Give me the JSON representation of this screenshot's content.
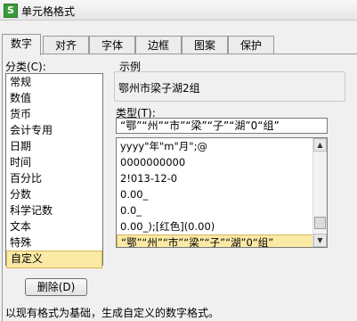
{
  "window": {
    "title": "单元格格式",
    "icon_text": "S"
  },
  "tabs": [
    {
      "label": "数字",
      "active": true
    },
    {
      "label": "对齐"
    },
    {
      "label": "字体"
    },
    {
      "label": "边框"
    },
    {
      "label": "图案"
    },
    {
      "label": "保护"
    }
  ],
  "category": {
    "label": "分类(C):",
    "items": [
      "常规",
      "数值",
      "货币",
      "会计专用",
      "日期",
      "时间",
      "百分比",
      "分数",
      "科学记数",
      "文本",
      "特殊",
      "自定义"
    ],
    "selected": "自定义"
  },
  "sample": {
    "label": "示例",
    "value": "鄂州市梁子湖2组"
  },
  "type": {
    "label": "类型(T):",
    "input_value": "“鄂”“州”“市”“梁”“子”“湖”0“组”",
    "list": [
      "yyyy\"年\"m\"月\";@",
      "0000000000",
      "2!013-12-0",
      "0.00_",
      "0.0_",
      "0.00_);[红色](0.00)",
      "“鄂”“州”“市”“梁”“子”“湖”0“组”"
    ],
    "selected_index": 6
  },
  "buttons": {
    "delete": "删除(D)"
  },
  "footer": {
    "text": "以现有格式为基础，生成自定义的数字格式。"
  }
}
